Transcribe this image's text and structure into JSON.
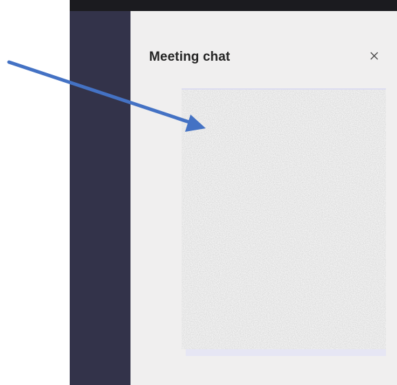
{
  "panel": {
    "title": "Meeting chat",
    "close_icon": "close-icon"
  },
  "chat": {
    "content_state": "obscured"
  },
  "colors": {
    "rail": "#33334a",
    "top_bar": "#1b1b1f",
    "panel_bg": "#f0efef",
    "arrow": "#4472c4"
  },
  "annotation": {
    "type": "arrow",
    "icon": "pointer-arrow-icon"
  }
}
